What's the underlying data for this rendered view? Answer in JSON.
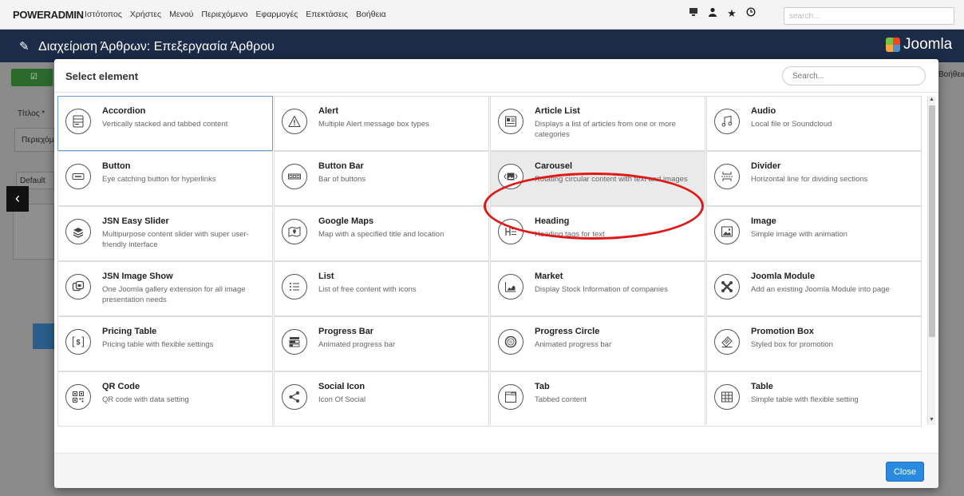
{
  "adminbar": {
    "brand_bold": "POWERADMIN",
    "menu": [
      "Ιστότοπος",
      "Χρήστες",
      "Μενού",
      "Περιεχόμενο",
      "Εφαρμογές",
      "Επεκτάσεις",
      "Βοήθεια"
    ],
    "icons": [
      "monitor-icon",
      "user-icon",
      "star-icon",
      "history-icon"
    ],
    "search_placeholder": "search..."
  },
  "titlebar": {
    "title": "Διαχείριση Άρθρων: Επεξεργασία Άρθρου",
    "logo": "Joomla"
  },
  "background": {
    "help": "Βοήθεια",
    "title_label": "Τίτλος *",
    "content_tab": "Περιεχόμ",
    "default_label": "Default"
  },
  "modal": {
    "title": "Select element",
    "search_placeholder": "Search...",
    "close_label": "Close",
    "elements": [
      {
        "name": "Accordion",
        "desc": "Vertically stacked and tabbed content",
        "icon": "accordion-icon"
      },
      {
        "name": "Alert",
        "desc": "Multiple Alert message box types",
        "icon": "alert-icon"
      },
      {
        "name": "Article List",
        "desc": "Displays a list of articles from one or more categories",
        "icon": "article-list-icon"
      },
      {
        "name": "Audio",
        "desc": "Local file or Soundcloud",
        "icon": "audio-icon"
      },
      {
        "name": "Button",
        "desc": "Eye catching button for hyperlinks",
        "icon": "button-icon"
      },
      {
        "name": "Button Bar",
        "desc": "Bar of buttons",
        "icon": "button-bar-icon"
      },
      {
        "name": "Carousel",
        "desc": "Rotating circular content with text and images",
        "icon": "carousel-icon"
      },
      {
        "name": "Divider",
        "desc": "Horizontal line for dividing sections",
        "icon": "divider-icon"
      },
      {
        "name": "JSN Easy Slider",
        "desc": "Multipurpose content slider with super user-friendly interface",
        "icon": "slider-icon"
      },
      {
        "name": "Google Maps",
        "desc": "Map with a specified title and location",
        "icon": "map-icon"
      },
      {
        "name": "Heading",
        "desc": "Heading tags for text",
        "icon": "heading-icon"
      },
      {
        "name": "Image",
        "desc": "Simple image with animation",
        "icon": "image-icon"
      },
      {
        "name": "JSN Image Show",
        "desc": "One Joomla gallery extension for all image presentation needs",
        "icon": "image-show-icon"
      },
      {
        "name": "List",
        "desc": "List of free content with icons",
        "icon": "list-icon"
      },
      {
        "name": "Market",
        "desc": "Display Stock Information of companies",
        "icon": "market-icon"
      },
      {
        "name": "Joomla Module",
        "desc": "Add an existing Joomla Module into page",
        "icon": "joomla-module-icon"
      },
      {
        "name": "Pricing Table",
        "desc": "Pricing table with flexible settings",
        "icon": "pricing-icon"
      },
      {
        "name": "Progress Bar",
        "desc": "Animated progress bar",
        "icon": "progress-bar-icon"
      },
      {
        "name": "Progress Circle",
        "desc": "Animated progress bar",
        "icon": "progress-circle-icon"
      },
      {
        "name": "Promotion Box",
        "desc": "Styled box for promotion",
        "icon": "promotion-icon"
      },
      {
        "name": "QR Code",
        "desc": "QR code with data setting",
        "icon": "qr-code-icon"
      },
      {
        "name": "Social Icon",
        "desc": "Icon Of Social",
        "icon": "share-icon"
      },
      {
        "name": "Tab",
        "desc": "Tabbed content",
        "icon": "tab-icon"
      },
      {
        "name": "Table",
        "desc": "Simple table with flexible setting",
        "icon": "table-icon"
      }
    ]
  },
  "colors": {
    "titlebar": "#1b2b48",
    "close_button": "#2a8ae0",
    "highlight_ellipse": "#e01818",
    "selected_border": "#6aa0d8"
  }
}
